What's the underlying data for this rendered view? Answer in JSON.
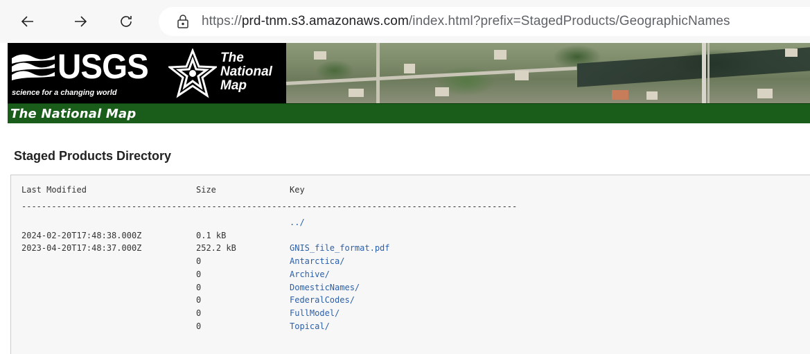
{
  "browser": {
    "url_scheme": "https://",
    "url_host": "prd-tnm.s3.amazonaws.com",
    "url_path": "/index.html?prefix=StagedProducts/GeographicNames",
    "back_icon": "arrow-left-icon",
    "forward_icon": "arrow-right-icon",
    "reload_icon": "reload-icon",
    "info_icon": "page-info-icon"
  },
  "banner": {
    "usgs": "USGS",
    "usgs_tagline": "science for a changing world",
    "tnm_line1": "The",
    "tnm_line2": "National",
    "tnm_line3": "Map"
  },
  "greenbar": {
    "title": "The National Map"
  },
  "page": {
    "title": "Staged Products Directory"
  },
  "listing": {
    "headers": {
      "modified": "Last Modified",
      "size": "Size",
      "key": "Key"
    },
    "separator": "---------------------------------------------------------------------------------------------------",
    "rows": [
      {
        "modified": "",
        "size": "",
        "key": "../"
      },
      {
        "modified": "2024-02-20T17:48:38.000Z",
        "size": "0.1 kB",
        "key": ""
      },
      {
        "modified": "2023-04-20T17:48:37.000Z",
        "size": "252.2 kB",
        "key": "GNIS_file_format.pdf"
      },
      {
        "modified": "",
        "size": "0",
        "key": "Antarctica/"
      },
      {
        "modified": "",
        "size": "0",
        "key": "Archive/"
      },
      {
        "modified": "",
        "size": "0",
        "key": "DomesticNames/"
      },
      {
        "modified": "",
        "size": "0",
        "key": "FederalCodes/"
      },
      {
        "modified": "",
        "size": "0",
        "key": "FullModel/"
      },
      {
        "modified": "",
        "size": "0",
        "key": "Topical/"
      }
    ]
  },
  "colors": {
    "link": "#2b5fa8",
    "greenbar": "#1a5c1a"
  }
}
